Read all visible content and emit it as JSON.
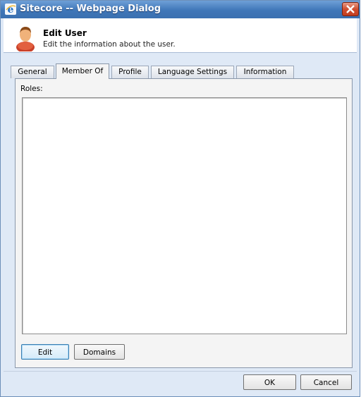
{
  "window": {
    "title": "Sitecore -- Webpage Dialog"
  },
  "header": {
    "title": "Edit User",
    "subtitle": "Edit the information about the user."
  },
  "tabs": [
    {
      "label": "General",
      "active": false
    },
    {
      "label": "Member Of",
      "active": true
    },
    {
      "label": "Profile",
      "active": false
    },
    {
      "label": "Language Settings",
      "active": false
    },
    {
      "label": "Information",
      "active": false
    }
  ],
  "panel": {
    "roles_label": "Roles:",
    "roles": []
  },
  "panel_buttons": {
    "edit_label": "Edit",
    "domains_label": "Domains"
  },
  "footer": {
    "ok_label": "OK",
    "cancel_label": "Cancel"
  },
  "colors": {
    "title_bar": "#3f76b8",
    "dialog_background": "#dfe9f6",
    "close_button": "#c94427"
  }
}
